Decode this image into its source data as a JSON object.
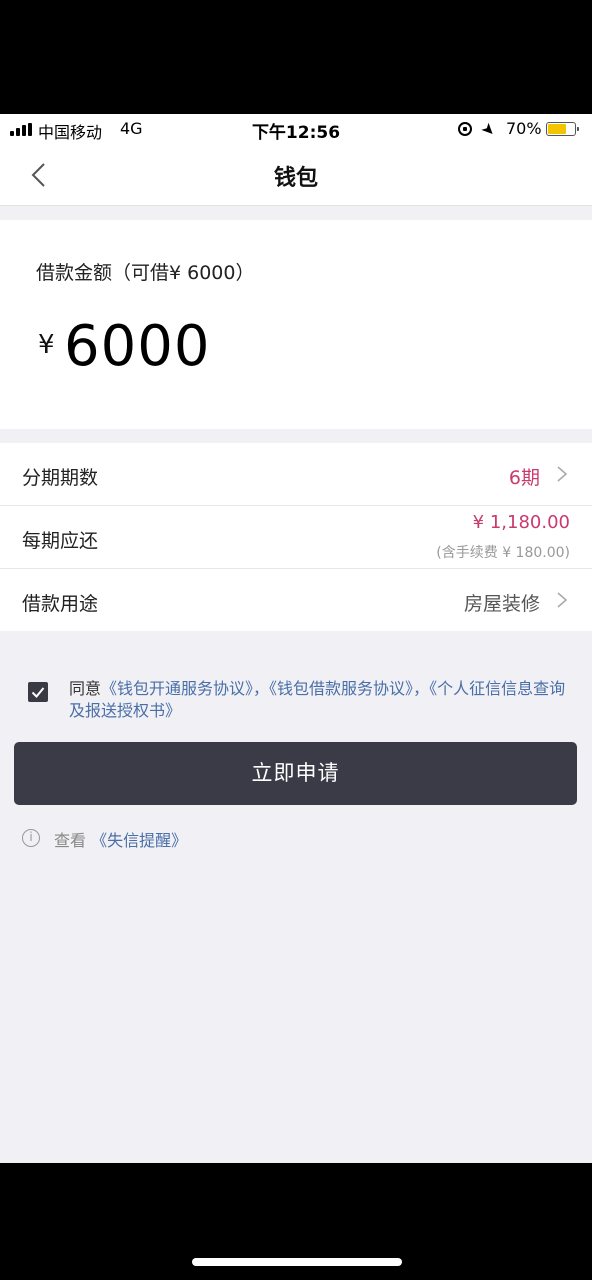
{
  "status_bar": {
    "carrier": "中国移动",
    "network": "4G",
    "time": "下午12:56",
    "battery": "70%",
    "battery_level": 0.7,
    "icons": [
      "signal-icon",
      "orientation-lock-icon",
      "location-icon",
      "battery-icon"
    ]
  },
  "nav": {
    "title": "钱包",
    "back_icon": "chevron-left-icon"
  },
  "loan": {
    "amount_label": "借款金额（可借¥ 6000）",
    "currency": "¥",
    "amount": "6000"
  },
  "rows": {
    "installments": {
      "label": "分期期数",
      "value": "6期"
    },
    "payment": {
      "label": "每期应还",
      "amount": "¥ 1,180.00",
      "fee": "(含手续费 ¥ 180.00)"
    },
    "purpose": {
      "label": "借款用途",
      "value": "房屋装修"
    }
  },
  "agreement": {
    "checked": true,
    "prefix": "同意",
    "links": [
      "《钱包开通服务协议》",
      "《钱包借款服务协议》",
      "《个人征信信息查询及报送授权书》"
    ],
    "separator": "，"
  },
  "apply_button": "立即申请",
  "reminder": {
    "prefix": "查看",
    "link": "《失信提醒》"
  },
  "colors": {
    "accent": "#c93a6e",
    "link": "#4a6fa8",
    "button": "#3a3b46",
    "background": "#f0f0f5",
    "battery": "#f2c500"
  }
}
